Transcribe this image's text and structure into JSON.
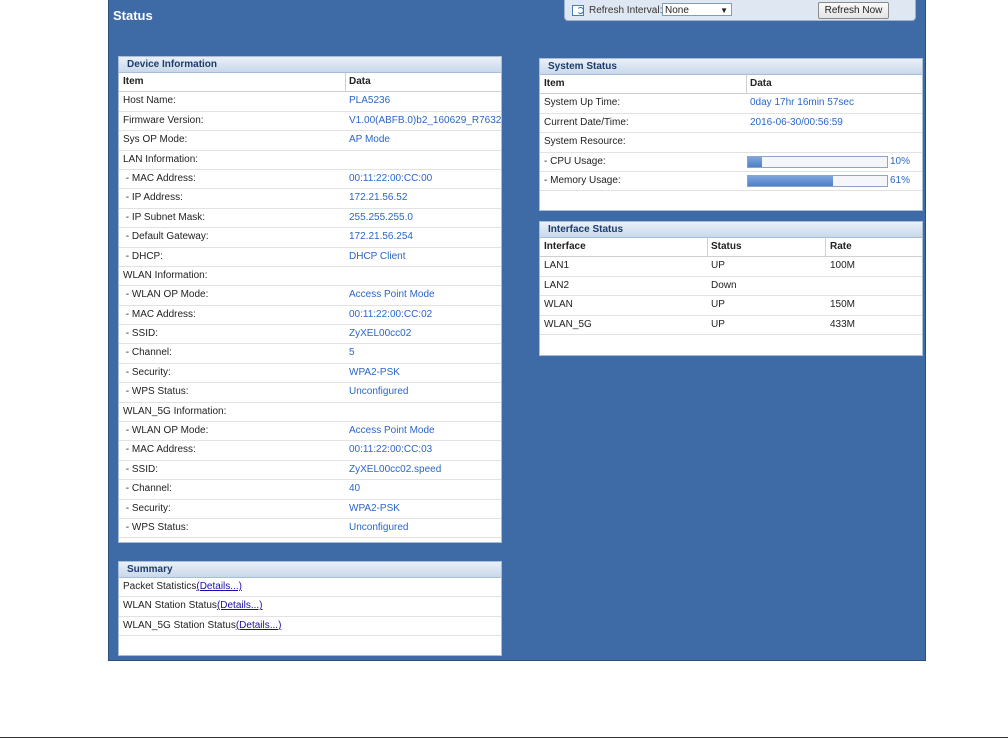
{
  "page": {
    "title": "Status"
  },
  "refresh": {
    "label": "Refresh Interval:",
    "interval": "None",
    "button": "Refresh Now"
  },
  "device_info": {
    "title": "Device Information",
    "col_item": "Item",
    "col_data": "Data",
    "rows": [
      [
        "Host Name:",
        "PLA5236"
      ],
      [
        "Firmware Version:",
        "V1.00(ABFB.0)b2_160629_R7632"
      ],
      [
        "Sys OP Mode:",
        "AP Mode"
      ],
      [
        "LAN Information:",
        ""
      ],
      [
        " - MAC Address:",
        "00:11:22:00:CC:00"
      ],
      [
        " - IP Address:",
        "172.21.56.52"
      ],
      [
        " - IP Subnet Mask:",
        "255.255.255.0"
      ],
      [
        " - Default Gateway:",
        "172.21.56.254"
      ],
      [
        " - DHCP:",
        "DHCP Client"
      ],
      [
        "WLAN Information:",
        ""
      ],
      [
        " - WLAN OP Mode:",
        "Access Point Mode"
      ],
      [
        " - MAC Address:",
        "00:11:22:00:CC:02"
      ],
      [
        " - SSID:",
        "ZyXEL00cc02"
      ],
      [
        " - Channel:",
        "5"
      ],
      [
        " - Security:",
        "WPA2-PSK"
      ],
      [
        " - WPS Status:",
        "Unconfigured"
      ],
      [
        "WLAN_5G Information:",
        ""
      ],
      [
        " - WLAN OP Mode:",
        "Access Point Mode"
      ],
      [
        " - MAC Address:",
        "00:11:22:00:CC:03"
      ],
      [
        " - SSID:",
        "ZyXEL00cc02.speed"
      ],
      [
        " - Channel:",
        "40"
      ],
      [
        " - Security:",
        "WPA2-PSK"
      ],
      [
        " - WPS Status:",
        "Unconfigured"
      ]
    ]
  },
  "system_status": {
    "title": "System Status",
    "col_item": "Item",
    "col_data": "Data",
    "uptime_label": "System Up Time:",
    "uptime": "0day 17hr 16min 57sec",
    "date_label": "Current Date/Time:",
    "date": "2016-06-30/00:56:59",
    "resource_label": "System Resource:",
    "cpu_label": "- CPU Usage:",
    "cpu_pct": "10%",
    "cpu_value": 0.1,
    "mem_label": "- Memory Usage:",
    "mem_pct": "61%",
    "mem_value": 0.61
  },
  "interface_status": {
    "title": "Interface Status",
    "col_interface": "Interface",
    "col_status": "Status",
    "col_rate": "Rate",
    "rows": [
      [
        "LAN1",
        "UP",
        "100M"
      ],
      [
        "LAN2",
        "Down",
        ""
      ],
      [
        "WLAN",
        "UP",
        "150M"
      ],
      [
        "WLAN_5G",
        "UP",
        "433M"
      ]
    ]
  },
  "summary": {
    "title": "Summary",
    "packet_label": "Packet Statistics",
    "wlan_label": "WLAN Station Status",
    "wlan5g_label": "WLAN_5G Station Status",
    "details_link": "(Details...)"
  },
  "colors": {
    "frame_bg": "#3e6aa6",
    "link": "#2a66c8",
    "bar_fill": "#4f7fc6"
  }
}
